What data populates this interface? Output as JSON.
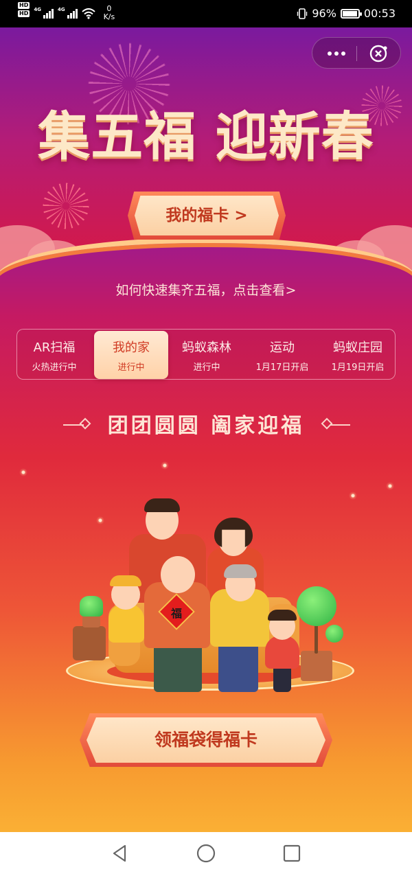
{
  "status_bar": {
    "hd_badges": [
      "HD",
      "HD"
    ],
    "network_labels": [
      "4G",
      "4G"
    ],
    "net_speed_value": "0",
    "net_speed_unit": "K/s",
    "battery_percent": "96%",
    "battery_level": 0.96,
    "time": "00:53"
  },
  "header": {
    "headline": "集五福 迎新春",
    "my_cards_button": "我的福卡 >"
  },
  "guide_link": "如何快速集齐五福，点击查看>",
  "tabs": [
    {
      "label": "AR扫福",
      "status": "火热进行中",
      "active": false
    },
    {
      "label": "我的家",
      "status": "进行中",
      "active": true
    },
    {
      "label": "蚂蚁森林",
      "status": "进行中",
      "active": false
    },
    {
      "label": "运动",
      "status": "1月17日开启",
      "active": false
    },
    {
      "label": "蚂蚁庄园",
      "status": "1月19日开启",
      "active": false
    }
  ],
  "section_title": "团团圆圆 阖家迎福",
  "illustration": {
    "fu_character": "福"
  },
  "cta_button": "领福袋得福卡",
  "colors": {
    "accent_red": "#e02a3c",
    "button_cream": "#ffe6c8",
    "button_text": "#c0391f",
    "headline_cream": "#fde8c7"
  },
  "icons": [
    "more-icon",
    "close-mini-program-icon",
    "back-icon",
    "home-icon",
    "recents-icon",
    "wifi-icon",
    "vibrate-icon",
    "battery-icon"
  ]
}
